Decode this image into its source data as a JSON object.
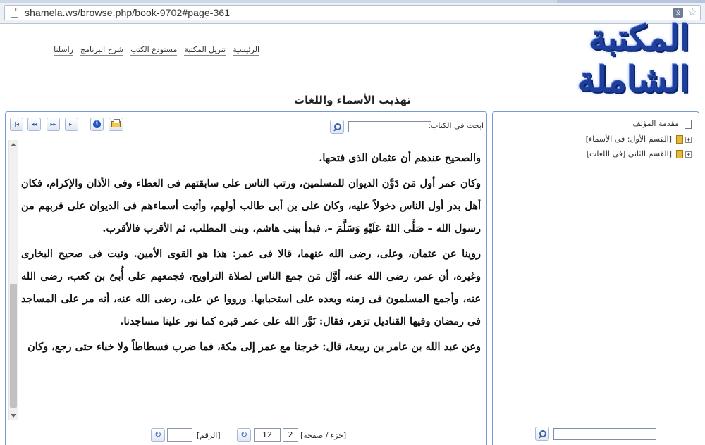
{
  "browser": {
    "url": "shamela.ws/browse.php/book-9702#page-361",
    "translate_icon": "文"
  },
  "site": {
    "logo_text": "المكتبة الشاملة",
    "nav": [
      "الرئيسية",
      "تنزيل المكتبة",
      "مستودع الكتب",
      "شرح البرنامج",
      "راسلنا"
    ]
  },
  "book": {
    "title": "تهذيب الأسماء واللغات"
  },
  "toolbar": {
    "search_label": "ابحث فى الكتاب:",
    "search_value": "",
    "nav_first": "|◂",
    "nav_prev": "◂◂",
    "nav_next": "▸▸",
    "nav_last": "▸|"
  },
  "content": {
    "paragraphs": [
      "والصحيح عندهم أن عثمان الذى فتحها.",
      "وكان عمر أول مَن دَوَّن الديوان للمسلمين، ورتب الناس على سابقتهم فى العطاء وفى الأذان والإكرام، فكان أهل بدر أول الناس دخولاً عليه، وكان على بن أبى طالب أولهم، وأثبت أسماءهم فى الديوان على قربهم من رسول الله – صَلَّى اللهُ عَلَيْهِ وَسَلَّمَ –، فبدأ ببنى هاشم، وبنى المطلب، ثم الأقرب فالأقرب.",
      "روينا عن عثمان، وعلى، رضى الله عنهما، قالا فى عمر: هذا هو القوى الأمين. وثبت فى صحيح البخارى وغيره، أن عمر، رضى الله عنه، أوَّل مَن جمع الناس لصلاة التراويح، فجمعهم على أُبىّ بن كعب، رضى الله عنه، وأجمع المسلمون فى زمنه وبعده على استحبابها. ورووا عن على، رضى الله عنه، أنه مر على المساجد فى رمضان وفيها القناديل تزهر، فقال: نَوَّر الله على عمر قبره كما نور علينا مساجدنا.",
      "وعن عبد الله بن عامر بن ربيعة، قال: خرجنا مع عمر إلى مكة، فما ضرب فسطاطاً ولا خباء حتى رجع، وكان"
    ]
  },
  "page_nav": {
    "part_page_label": "[جزء / صفحة]",
    "part_value": "2",
    "page_value": "12",
    "number_label": "[الرقم]",
    "number_value": "",
    "go_symbol": "↻"
  },
  "toc": {
    "items": [
      {
        "label": "مقدمة المؤلف"
      },
      {
        "label": "[القسم الأول: فى الأسماء]"
      },
      {
        "label": "[القسم الثانى [فى اللغات]"
      }
    ],
    "search_value": ""
  }
}
